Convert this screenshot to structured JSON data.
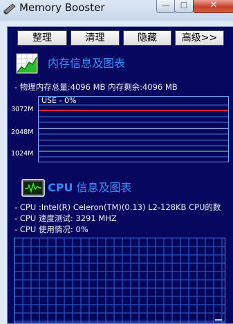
{
  "window": {
    "title": "Memory Booster",
    "minimize_glyph": "—",
    "maximize_glyph": "☐",
    "close_glyph": "✕"
  },
  "tabs": [
    {
      "label": "整理"
    },
    {
      "label": "清理"
    },
    {
      "label": "隐藏"
    },
    {
      "label": "高级>>"
    }
  ],
  "memory": {
    "section_title": "内存信息及图表",
    "summary": "- 物理内存总量:4096 MB  内存剩余:4096 MB",
    "graph": {
      "use_label": "USE - 0%",
      "y_labels": [
        "3072M",
        "2048M",
        "1024M"
      ],
      "usage_percent": 0
    }
  },
  "cpu": {
    "section_title_prefix": "CPU",
    "section_title_suffix": " 信息及图表",
    "lines": [
      "- CPU :Intel(R) Celeron(TM)(0.13) L2-128KB CPU的数",
      "- CPU 速度测试: 3291 MHZ",
      "- CPU 使用情况:  0%"
    ],
    "usage_percent": 0
  },
  "colors": {
    "panel_bg": "#07075f",
    "title_accent": "#3a8fff",
    "mem_line_red": "#d3263a",
    "mem_line_green": "#3bbf3b",
    "grid_blue": "#3a78e8"
  }
}
